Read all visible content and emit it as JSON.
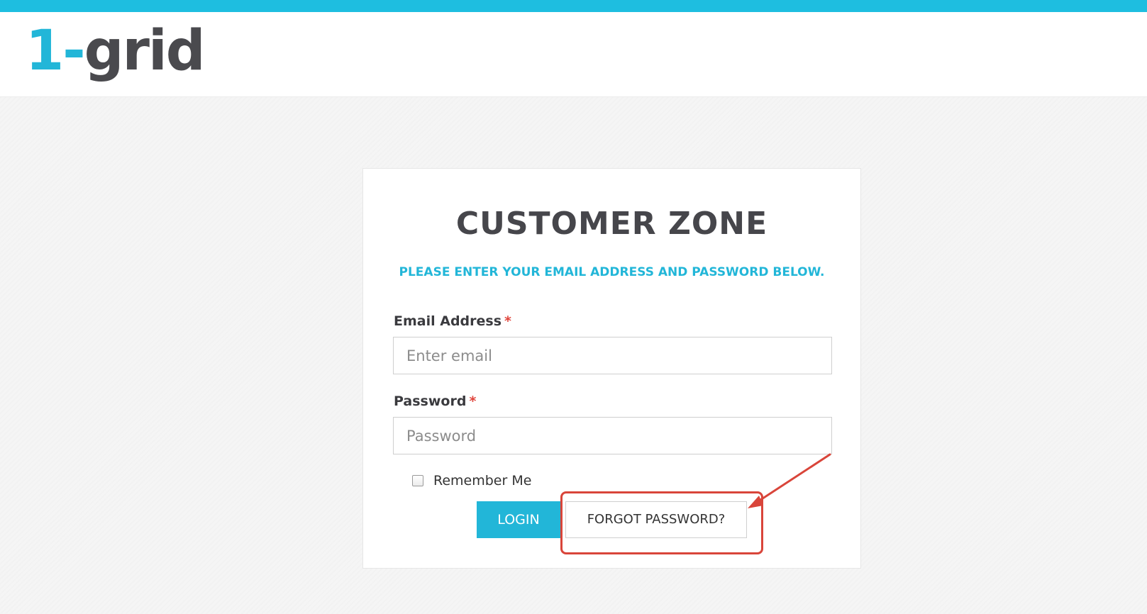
{
  "header": {
    "logo_part1": "1-",
    "logo_part2": "grid"
  },
  "card": {
    "title": "CUSTOMER ZONE",
    "subtitle": "PLEASE ENTER YOUR EMAIL ADDRESS AND PASSWORD BELOW."
  },
  "form": {
    "email_label": "Email Address",
    "email_placeholder": "Enter email",
    "email_value": "",
    "password_label": "Password",
    "password_placeholder": "Password",
    "password_value": "",
    "required_marker": "*",
    "remember_label": "Remember Me",
    "remember_checked": false,
    "login_label": "LOGIN",
    "forgot_label": "FORGOT PASSWORD?"
  },
  "colors": {
    "accent": "#22b6d8",
    "text_dark": "#46464b",
    "annotation": "#d9453a"
  },
  "icons": {
    "annotation_arrow": "arrow-icon"
  }
}
